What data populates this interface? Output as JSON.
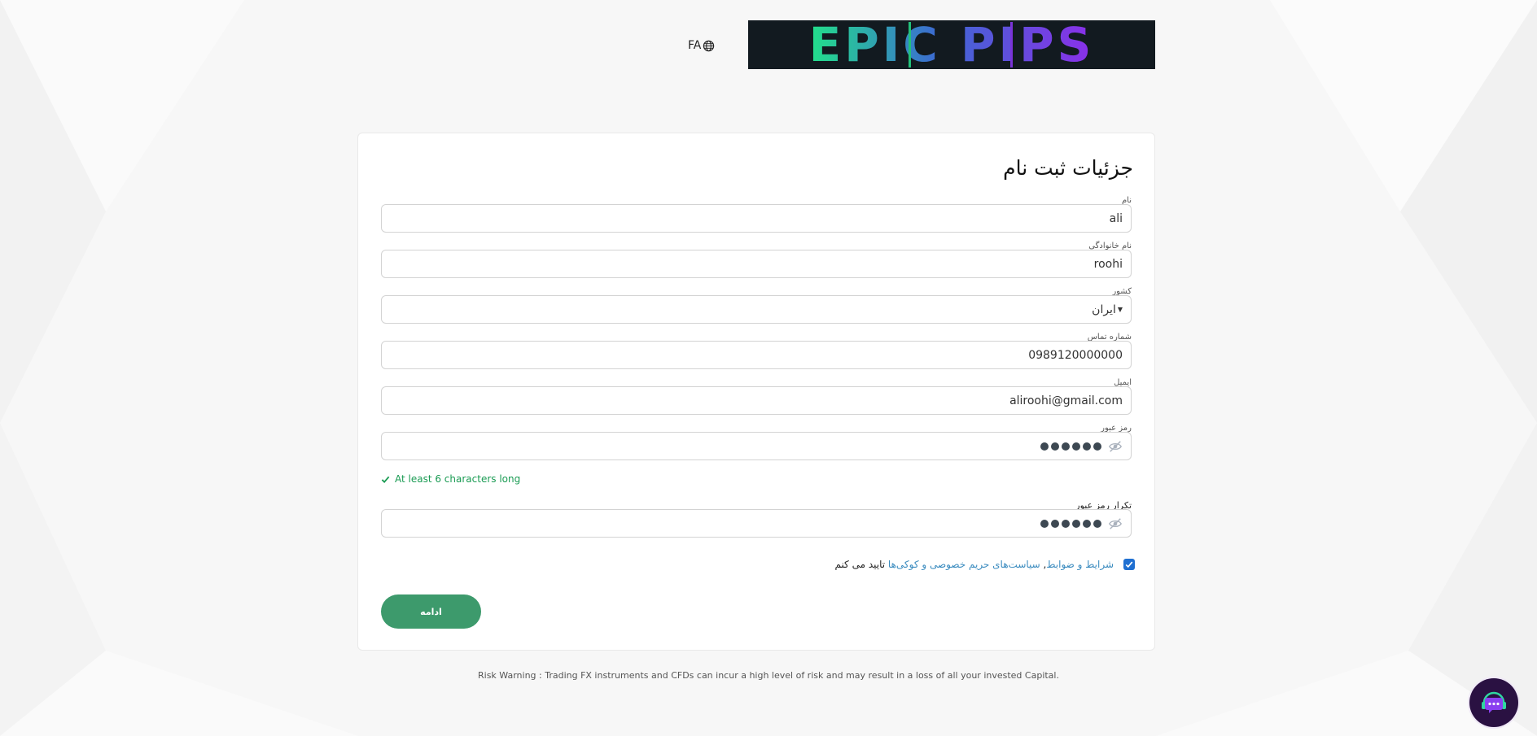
{
  "header": {
    "language_label": "FA",
    "logo_text": "EPIC PIPS"
  },
  "form": {
    "title": "جزئیات ثبت نام",
    "fields": {
      "first_name": {
        "label": "نام",
        "value": "ali"
      },
      "last_name": {
        "label": "نام خانوادگی",
        "value": "roohi"
      },
      "country": {
        "label": "کشور",
        "value": "ایران"
      },
      "phone": {
        "label": "شماره تماس",
        "value": "0989120000000"
      },
      "email": {
        "label": "ایمیل",
        "value": "aliroohi@gmail.com"
      },
      "password": {
        "label": "رمز عبور"
      },
      "confirm_password": {
        "label": "تکرار رمز عبور"
      }
    },
    "password_hint": "At least 6 characters long",
    "terms": {
      "link_terms": "شرایط و ضوابط",
      "separator": ",",
      "link_privacy": "سیاست‌های حریم خصوصی و کوکی‌ها",
      "suffix": "تایید می کنم"
    },
    "continue_label": "ادامه"
  },
  "footer": {
    "risk_warning": "Risk Warning : Trading FX instruments and CFDs can incur a high level of risk and may result in a loss of all your invested Capital."
  },
  "colors": {
    "brand_green": "#3d9a6c",
    "hint_green": "#1a9b53",
    "link_blue": "#3a8bbf",
    "support_purple": "#2a1142"
  },
  "icons": {
    "language": "globe-icon",
    "password_toggle": "eye-slash-icon",
    "hint": "check-icon",
    "support": "support-chat-icon"
  }
}
